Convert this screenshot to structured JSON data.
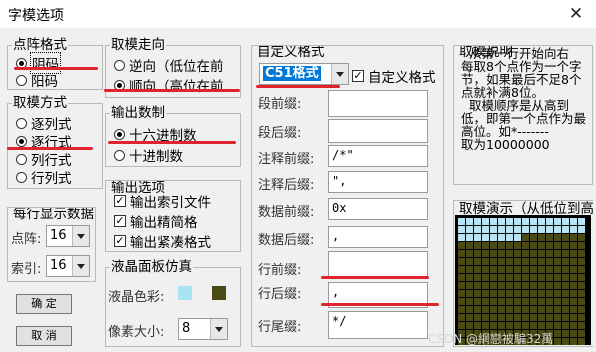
{
  "window": {
    "title": "字模选项",
    "close_glyph": "✕"
  },
  "dot_format": {
    "label": "点阵格式",
    "options": [
      "阴码",
      "阳码"
    ],
    "selected": 0
  },
  "mode": {
    "label": "取模方式",
    "options": [
      "逐列式",
      "逐行式",
      "列行式",
      "行列式"
    ],
    "selected": 1
  },
  "direction": {
    "label": "取模走向",
    "options": [
      "逆向（低位在前",
      "顺向（高位在前"
    ],
    "selected": 1
  },
  "output_base": {
    "label": "输出数制",
    "options": [
      "十六进制数",
      "十进制数"
    ],
    "selected": 0
  },
  "output_options": {
    "label": "输出选项",
    "items": [
      {
        "label": "输出索引文件",
        "checked": true
      },
      {
        "label": "输出精简格",
        "checked": true
      },
      {
        "label": "输出紧凑格式",
        "checked": true
      }
    ]
  },
  "per_row": {
    "label": "每行显示数据",
    "dot_label": "点阵:",
    "dot_value": "16",
    "index_label": "索引:",
    "index_value": "16"
  },
  "buttons": {
    "ok": "确  定",
    "cancel": "取  消"
  },
  "lcd": {
    "label": "液晶面板仿真",
    "color_label": "液晶色彩:",
    "color_a": "#a9e3f4",
    "color_b": "#4a4a14",
    "pixel_label": "像素大小:",
    "pixel_value": "8"
  },
  "custom": {
    "label": "自定义格式",
    "combo_value": "C51格式",
    "check_label": "自定义格式",
    "checked": true,
    "fields": [
      {
        "label": "段前缀:",
        "value": ""
      },
      {
        "label": "段后缀:",
        "value": ""
      },
      {
        "label": "注释前缀:",
        "value": "/*\""
      },
      {
        "label": "注释后缀:",
        "value": "\","
      },
      {
        "label": "数据前缀:",
        "value": "0x"
      },
      {
        "label": "数据后缀:",
        "value": ","
      },
      {
        "label": "行前缀:",
        "value": ""
      },
      {
        "label": "行后缀:",
        "value": ","
      },
      {
        "label": "行尾缀:",
        "value": "*/"
      }
    ]
  },
  "description": {
    "label": "取模说明",
    "text": "  从第一行开始向右\n每取8个点作为一个字\n节，如果最后不足8个\n点就补满8位。\n  取模顺序是从高到\n低，即第一个点作为最\n高位。如*-------\n取为10000000"
  },
  "preview": {
    "label": "取模演示（从低位到高位）",
    "cols": 16,
    "rows": 16,
    "lit_rows": 2,
    "lit_cols_row3": [
      0,
      1,
      2,
      3,
      4,
      5,
      6,
      7
    ]
  },
  "watermark": "CSDN @網戀被騙32萬",
  "colors": {
    "annotation_red": "#e0242d",
    "selection_blue": "#0078d7"
  }
}
